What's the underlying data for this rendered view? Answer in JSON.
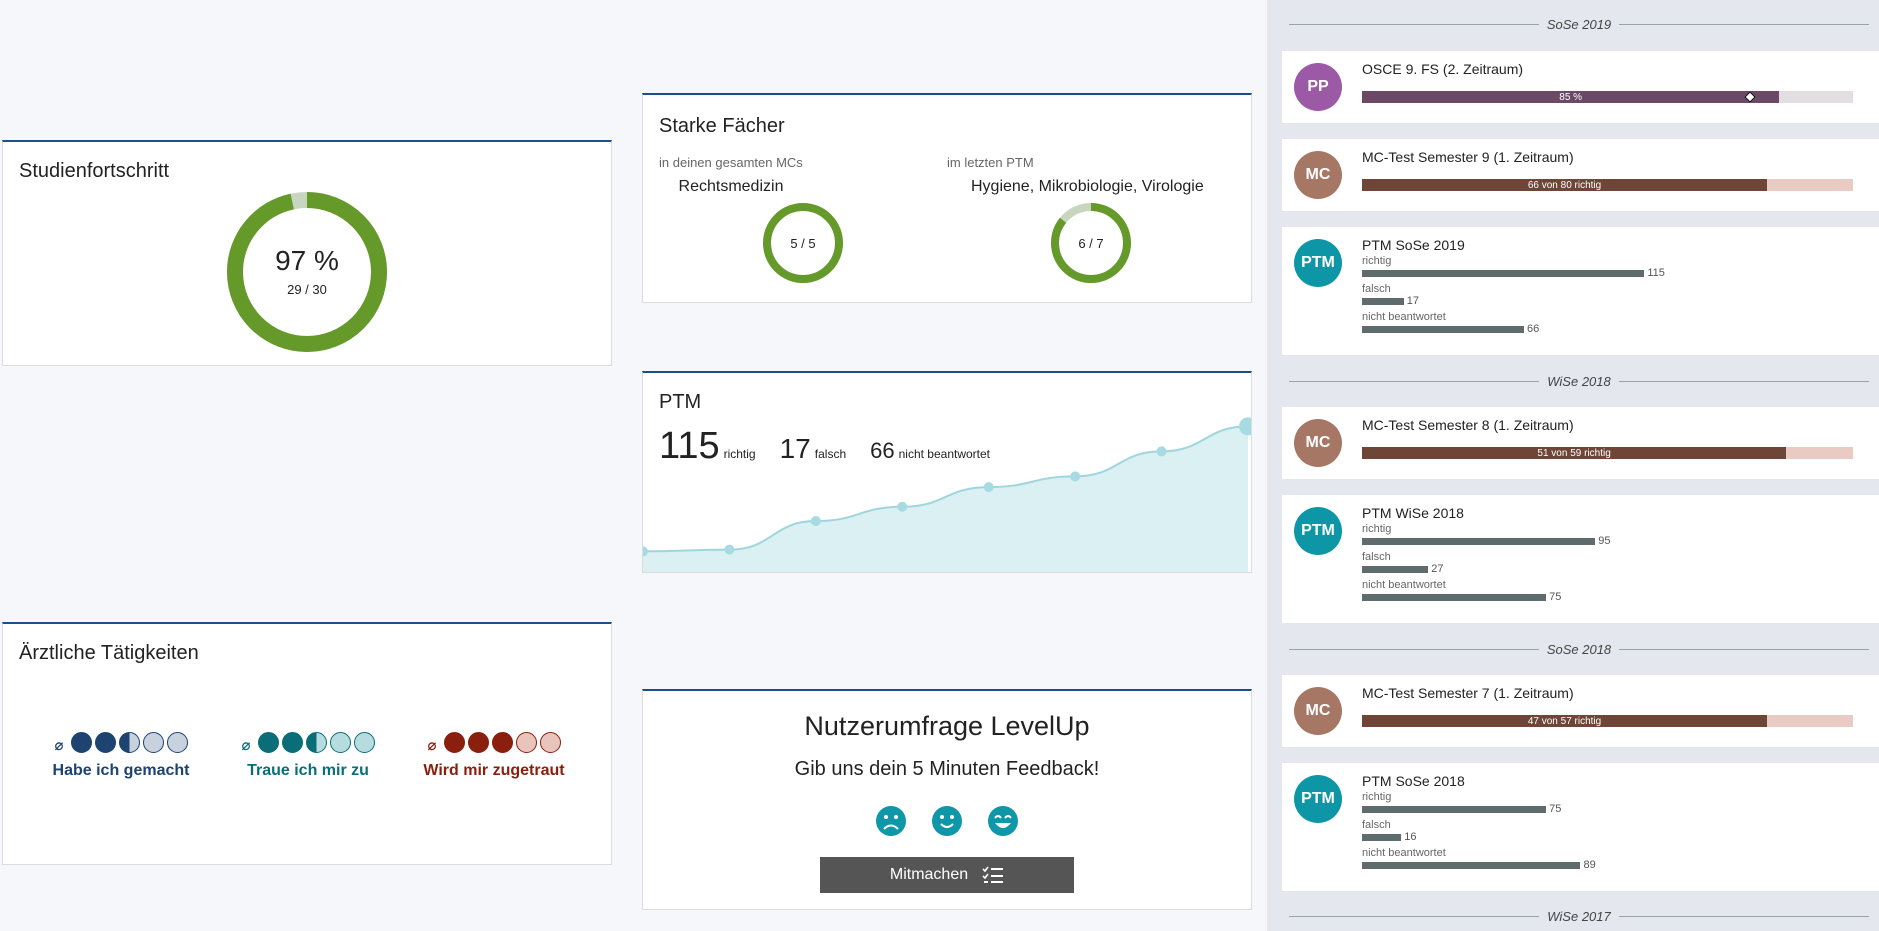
{
  "progress": {
    "title": "Studienfortschritt",
    "percent_text": "97 %",
    "fraction_text": "29 / 30",
    "done": 29,
    "total": 30
  },
  "strong": {
    "title": "Starke Fächer",
    "left": {
      "sub": "in deinen gesamten MCs",
      "subject": "Rechtsmedizin",
      "ratio_text": "5 / 5",
      "value": 5,
      "total": 5
    },
    "right": {
      "sub": "im letzten PTM",
      "subject": "Hygiene, Mikrobiologie, Virologie",
      "ratio_text": "6 / 7",
      "value": 6,
      "total": 7
    }
  },
  "ptm": {
    "title": "PTM",
    "correct": "115",
    "correct_label": "richtig",
    "wrong": "17",
    "wrong_label": "falsch",
    "unanswered": "66",
    "unanswered_label": "nicht beantwortet",
    "chart_data": {
      "type": "area",
      "values": [
        2,
        3,
        19,
        27,
        38,
        44,
        58,
        72
      ]
    }
  },
  "activities": {
    "title": "Ärztliche Tätigkeiten",
    "avg_symbol": "⌀",
    "groups": [
      {
        "label": "Habe ich gemacht",
        "color": "#1d4370",
        "light": "#c8d2de",
        "filled": 2.5
      },
      {
        "label": "Traue ich mir zu",
        "color": "#0a6d78",
        "light": "#b6dcdf",
        "filled": 2.5
      },
      {
        "label": "Wird mir zugetraut",
        "color": "#8a1f0e",
        "light": "#e9c4bd",
        "filled": 3
      }
    ]
  },
  "survey": {
    "title": "Nutzerumfrage LevelUp",
    "subtitle": "Gib uns dein 5 Minuten Feedback!",
    "button": "Mitmachen",
    "accent": "#0f96a8"
  },
  "timeline": {
    "semesters": [
      "SoSe 2019",
      "WiSe 2018",
      "SoSe 2018",
      "WiSe 2017"
    ],
    "entries": [
      {
        "kind": "osce",
        "avatar": "PP",
        "avatar_color": "#9b59a6",
        "title": "OSCE 9. FS (2. Zeitraum)",
        "bar_text": "85 %",
        "fraction": 0.85,
        "marker": 0.79,
        "fill": "#6b4866",
        "track": "#e3dee2"
      },
      {
        "kind": "mc",
        "avatar": "MC",
        "avatar_color": "#a57764",
        "title": "MC-Test Semester 9 (1. Zeitraum)",
        "bar_text": "66 von 80 richtig",
        "fraction": 0.825,
        "fill": "#6e4536",
        "track": "#e9cbc3"
      },
      {
        "kind": "ptm",
        "avatar": "PTM",
        "avatar_color": "#0d97a6",
        "title": "PTM SoSe 2019",
        "rows": [
          {
            "label": "richtig",
            "value": "115",
            "n": 115
          },
          {
            "label": "falsch",
            "value": "17",
            "n": 17
          },
          {
            "label": "nicht beantwortet",
            "value": "66",
            "n": 66
          }
        ]
      },
      {
        "kind": "mc",
        "avatar": "MC",
        "avatar_color": "#a57764",
        "title": "MC-Test Semester 8 (1. Zeitraum)",
        "bar_text": "51 von 59 richtig",
        "fraction": 0.864,
        "fill": "#6e4536",
        "track": "#e9cbc3"
      },
      {
        "kind": "ptm",
        "avatar": "PTM",
        "avatar_color": "#0d97a6",
        "title": "PTM WiSe 2018",
        "rows": [
          {
            "label": "richtig",
            "value": "95",
            "n": 95
          },
          {
            "label": "falsch",
            "value": "27",
            "n": 27
          },
          {
            "label": "nicht beantwortet",
            "value": "75",
            "n": 75
          }
        ]
      },
      {
        "kind": "mc",
        "avatar": "MC",
        "avatar_color": "#a57764",
        "title": "MC-Test Semester 7 (1. Zeitraum)",
        "bar_text": "47 von 57 richtig",
        "fraction": 0.825,
        "fill": "#6e4536",
        "track": "#e9cbc3"
      },
      {
        "kind": "ptm",
        "avatar": "PTM",
        "avatar_color": "#0d97a6",
        "title": "PTM SoSe 2018",
        "rows": [
          {
            "label": "richtig",
            "value": "75",
            "n": 75
          },
          {
            "label": "falsch",
            "value": "16",
            "n": 16
          },
          {
            "label": "nicht beantwortet",
            "value": "89",
            "n": 89
          }
        ]
      }
    ]
  }
}
